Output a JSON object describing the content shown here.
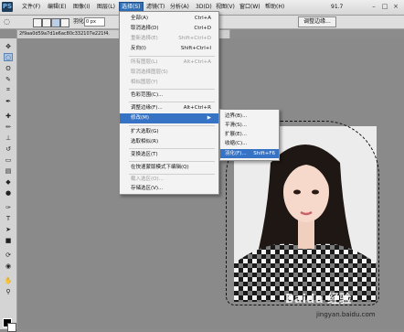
{
  "menubar": {
    "logo": "PS",
    "items": [
      "文件(F)",
      "编辑(E)",
      "图像(I)",
      "图层(L)",
      "选择(S)",
      "滤镜(T)",
      "分析(A)",
      "3D(D)",
      "视图(V)",
      "窗口(W)",
      "帮助(H)"
    ],
    "active_index": 4,
    "zoom": "91.7"
  },
  "options": {
    "feather_label": "羽化:",
    "feather_value": "0 px",
    "refine_edge": "调整边缘..."
  },
  "document": {
    "tab_title": "2f9aa0d59a7d1e6ac80c332107e221f4."
  },
  "select_menu": {
    "items": [
      {
        "label": "全部(A)",
        "shortcut": "Ctrl+A",
        "disabled": false
      },
      {
        "label": "取消选择(D)",
        "shortcut": "Ctrl+D",
        "disabled": false
      },
      {
        "label": "重新选择(E)",
        "shortcut": "Shift+Ctrl+D",
        "disabled": true
      },
      {
        "label": "反向(I)",
        "shortcut": "Shift+Ctrl+I",
        "disabled": false
      },
      {
        "label": "所有图层(L)",
        "shortcut": "Alt+Ctrl+A",
        "disabled": true
      },
      {
        "label": "取消选择图层(S)",
        "shortcut": "",
        "disabled": true
      },
      {
        "label": "相似图层(Y)",
        "shortcut": "",
        "disabled": true
      },
      {
        "label": "色彩范围(C)...",
        "shortcut": "",
        "disabled": false
      },
      {
        "label": "调整边缘(F)...",
        "shortcut": "Alt+Ctrl+R",
        "disabled": false
      },
      {
        "label": "修改(M)",
        "shortcut": "",
        "disabled": false,
        "highlighted": true,
        "submenu": true
      },
      {
        "label": "扩大选取(G)",
        "shortcut": "",
        "disabled": false
      },
      {
        "label": "选取相似(R)",
        "shortcut": "",
        "disabled": false
      },
      {
        "label": "变换选区(T)",
        "shortcut": "",
        "disabled": false
      },
      {
        "label": "在快速蒙版模式下编辑(Q)",
        "shortcut": "",
        "disabled": false
      },
      {
        "label": "载入选区(O)...",
        "shortcut": "",
        "disabled": true
      },
      {
        "label": "存储选区(V)...",
        "shortcut": "",
        "disabled": false
      }
    ]
  },
  "modify_submenu": {
    "items": [
      {
        "label": "边界(B)...",
        "shortcut": ""
      },
      {
        "label": "平滑(S)...",
        "shortcut": ""
      },
      {
        "label": "扩展(E)...",
        "shortcut": ""
      },
      {
        "label": "收缩(C)...",
        "shortcut": ""
      },
      {
        "label": "羽化(F)...",
        "shortcut": "Shift+F6",
        "highlighted": true
      }
    ]
  },
  "watermark": {
    "text": "Baidu 经验",
    "url": "jingyan.baidu.com"
  },
  "colors": {
    "menu_highlight": "#3673c4",
    "active_menu": "#2f6fb8",
    "workspace": "#8a8a8a"
  }
}
